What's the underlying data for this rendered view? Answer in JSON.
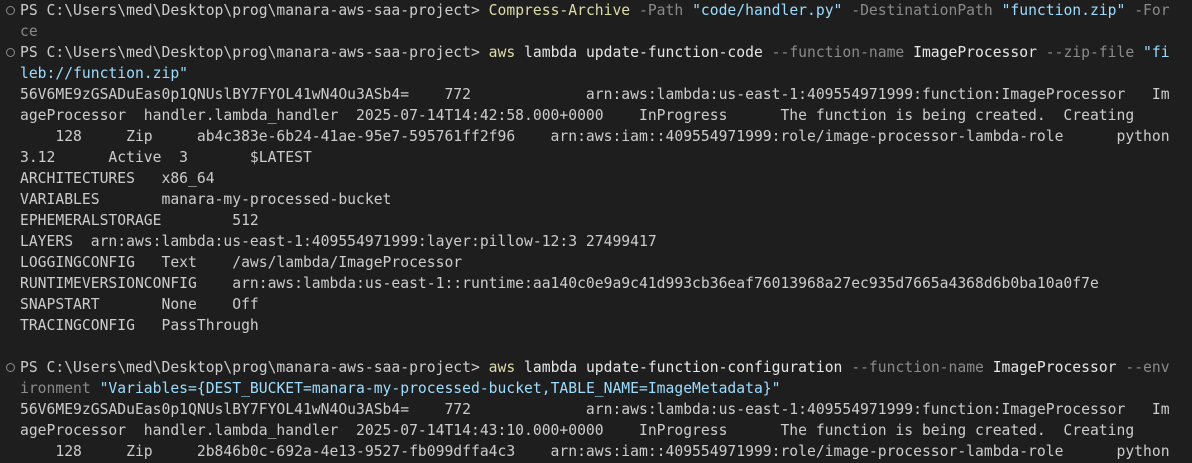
{
  "terminal": {
    "lines": [
      {
        "marker": true,
        "tokens": [
          {
            "t": "PS C:\\Users\\med\\Desktop\\prog\\manara-aws-saa-project> ",
            "c": "plain"
          },
          {
            "t": "Compress-Archive",
            "c": "cmd"
          },
          {
            "t": " -Path ",
            "c": "param"
          },
          {
            "t": "\"code/handler.py\"",
            "c": "str"
          },
          {
            "t": " -DestinationPath ",
            "c": "param"
          },
          {
            "t": "\"function.zip\"",
            "c": "str"
          },
          {
            "t": " -For",
            "c": "param"
          }
        ]
      },
      {
        "tokens": [
          {
            "t": "ce",
            "c": "param"
          }
        ]
      },
      {
        "marker": true,
        "tokens": [
          {
            "t": "PS C:\\Users\\med\\Desktop\\prog\\manara-aws-saa-project> ",
            "c": "plain"
          },
          {
            "t": "aws",
            "c": "cmd"
          },
          {
            "t": " lambda update-function-code ",
            "c": "arg"
          },
          {
            "t": "--function-name",
            "c": "param"
          },
          {
            "t": " ImageProcessor ",
            "c": "arg"
          },
          {
            "t": "--zip-file",
            "c": "param"
          },
          {
            "t": " \"fi",
            "c": "str"
          }
        ]
      },
      {
        "tokens": [
          {
            "t": "leb://function.zip\"",
            "c": "str"
          }
        ]
      },
      {
        "tokens": [
          {
            "t": "56V6ME9zGSADuEas0p1QNUslBY7FYOL41wN4Ou3ASb4=    772             arn:aws:lambda:us-east-1:409554971999:function:ImageProcessor   Im",
            "c": "plain"
          }
        ]
      },
      {
        "tokens": [
          {
            "t": "ageProcessor  handler.lambda_handler  2025-07-14T14:42:58.000+0000    InProgress      The function is being created.  Creating",
            "c": "plain"
          }
        ]
      },
      {
        "tokens": [
          {
            "t": "    128     Zip     ab4c383e-6b24-41ae-95e7-595761ff2f96    arn:aws:iam::409554971999:role/image-processor-lambda-role      python",
            "c": "plain"
          }
        ]
      },
      {
        "tokens": [
          {
            "t": "3.12      Active  3       $LATEST",
            "c": "plain"
          }
        ]
      },
      {
        "tokens": [
          {
            "t": "ARCHITECTURES   x86_64",
            "c": "plain"
          }
        ]
      },
      {
        "tokens": [
          {
            "t": "VARIABLES       manara-my-processed-bucket",
            "c": "plain"
          }
        ]
      },
      {
        "tokens": [
          {
            "t": "EPHEMERALSTORAGE        512",
            "c": "plain"
          }
        ]
      },
      {
        "tokens": [
          {
            "t": "LAYERS  arn:aws:lambda:us-east-1:409554971999:layer:pillow-12:3 27499417",
            "c": "plain"
          }
        ]
      },
      {
        "tokens": [
          {
            "t": "LOGGINGCONFIG   Text    /aws/lambda/ImageProcessor",
            "c": "plain"
          }
        ]
      },
      {
        "tokens": [
          {
            "t": "RUNTIMEVERSIONCONFIG    arn:aws:lambda:us-east-1::runtime:aa140c0e9a9c41d993cb36eaf76013968a27ec935d7665a4368d6b0ba10a0f7e",
            "c": "plain"
          }
        ]
      },
      {
        "tokens": [
          {
            "t": "SNAPSTART       None    Off",
            "c": "plain"
          }
        ]
      },
      {
        "tokens": [
          {
            "t": "TRACINGCONFIG   PassThrough",
            "c": "plain"
          }
        ]
      },
      {
        "tokens": [
          {
            "t": "",
            "c": "plain"
          }
        ]
      },
      {
        "marker": true,
        "tokens": [
          {
            "t": "PS C:\\Users\\med\\Desktop\\prog\\manara-aws-saa-project> ",
            "c": "plain"
          },
          {
            "t": "aws",
            "c": "cmd"
          },
          {
            "t": " lambda update-function-configuration ",
            "c": "arg"
          },
          {
            "t": "--function-name",
            "c": "param"
          },
          {
            "t": " ImageProcessor ",
            "c": "arg"
          },
          {
            "t": "--env",
            "c": "param"
          }
        ]
      },
      {
        "tokens": [
          {
            "t": "ironment ",
            "c": "param"
          },
          {
            "t": "\"Variables={DEST_BUCKET=manara-my-processed-bucket,TABLE_NAME=ImageMetadata}\"",
            "c": "str"
          }
        ]
      },
      {
        "tokens": [
          {
            "t": "56V6ME9zGSADuEas0p1QNUslBY7FYOL41wN4Ou3ASb4=    772             arn:aws:lambda:us-east-1:409554971999:function:ImageProcessor   Im",
            "c": "plain"
          }
        ]
      },
      {
        "tokens": [
          {
            "t": "ageProcessor  handler.lambda_handler  2025-07-14T14:43:10.000+0000    InProgress      The function is being created.  Creating",
            "c": "plain"
          }
        ]
      },
      {
        "tokens": [
          {
            "t": "    128     Zip     2b846b0c-692a-4e13-9527-fb099dffa4c3    arn:aws:iam::409554971999:role/image-processor-lambda-role      python",
            "c": "plain"
          }
        ]
      }
    ]
  }
}
